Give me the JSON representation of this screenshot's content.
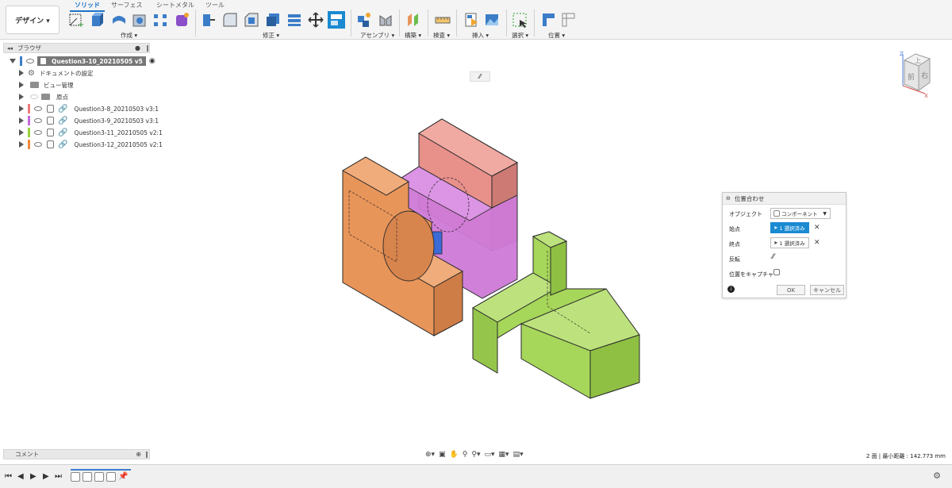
{
  "toolbar": {
    "workspace_label": "デザイン ▾",
    "tabs": [
      "ソリッド",
      "サーフェス",
      "シートメタル",
      "ツール"
    ],
    "groups": [
      "作成 ▾",
      "修正 ▾",
      "アセンブリ ▾",
      "構築 ▾",
      "検査 ▾",
      "挿入 ▾",
      "選択 ▾",
      "位置 ▾"
    ]
  },
  "browser": {
    "header": "ブラウザ",
    "root_label": "Question3-10_20210505 v5",
    "items": [
      {
        "label": "ドキュメントの設定"
      },
      {
        "label": "ビュー管理"
      },
      {
        "label": "原点"
      },
      {
        "label": "Question3-8_20210503 v3:1",
        "color": "#f07a7a"
      },
      {
        "label": "Question3-9_20210503 v3:1",
        "color": "#c26ad8"
      },
      {
        "label": "Question3-11_20210505 v2:1",
        "color": "#9ad13a"
      },
      {
        "label": "Question3-12_20210505 v2:1",
        "color": "#f08a3c"
      }
    ]
  },
  "comments": {
    "label": "コメント"
  },
  "viewcube": {
    "top_label": "上",
    "front_label": "前",
    "right_label": "右",
    "axis_z": "Z",
    "axis_x": "X"
  },
  "status": {
    "text": "2 面 | 最小距離 : 142.773 mm"
  },
  "dialog": {
    "title": "位置合わせ",
    "object_label": "オブジェクト",
    "object_value": "コンポーネント",
    "from_label": "始点",
    "from_value": "1 選択済み",
    "to_label": "終点",
    "to_value": "1 選択済み",
    "flip_label": "反転",
    "capture_label": "位置をキャプチャ",
    "ok_label": "OK",
    "cancel_label": "キャンセル"
  },
  "colors": {
    "accent": "#1a8ad1",
    "part_orange": "#e8955a",
    "part_pink": "#e8908a",
    "part_purple": "#cf7ad8",
    "part_green": "#a6d65a"
  }
}
